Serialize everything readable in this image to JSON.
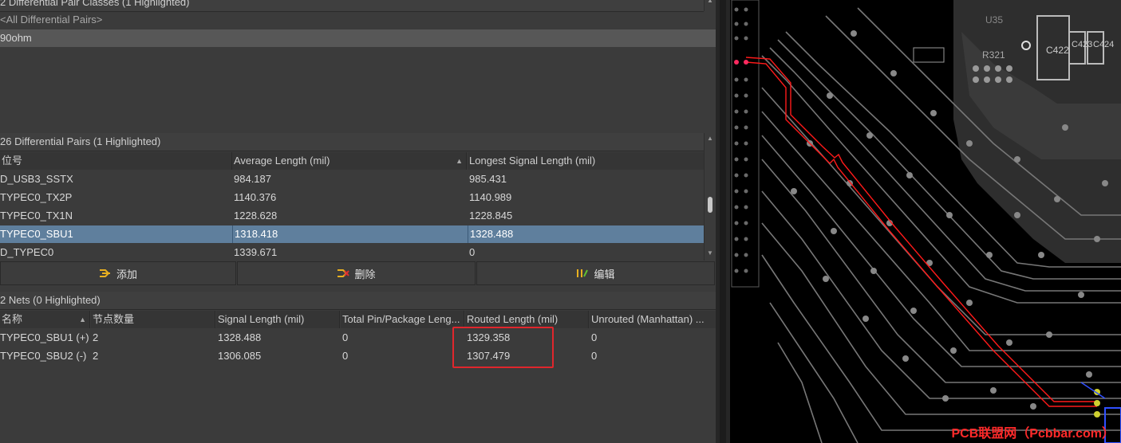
{
  "classes_section": {
    "title": "2 Differential Pair Classes (1 Highlighted)",
    "items": [
      "<All Differential Pairs>",
      "90ohm"
    ]
  },
  "pairs_section": {
    "title": "26 Differential Pairs (1 Highlighted)",
    "columns": [
      "位号",
      "Average Length (mil)",
      "Longest Signal Length (mil)"
    ],
    "rows": [
      [
        "D_USB3_SSTX",
        "984.187",
        "985.431"
      ],
      [
        "TYPEC0_TX2P",
        "1140.376",
        "1140.989"
      ],
      [
        "TYPEC0_TX1N",
        "1228.628",
        "1228.845"
      ],
      [
        "TYPEC0_SBU1",
        "1318.418",
        "1328.488"
      ],
      [
        "D_TYPEC0",
        "1339.671",
        "0"
      ]
    ],
    "highlighted_row": "TYPEC0_SBU1"
  },
  "buttons": {
    "add": "添加",
    "delete": "删除",
    "edit": "编辑"
  },
  "nets_section": {
    "title": "2 Nets (0 Highlighted)",
    "columns": [
      "名称",
      "节点数量",
      "Signal Length (mil)",
      "Total Pin/Package Leng...",
      "Routed Length (mil)",
      "Unrouted (Manhattan) ..."
    ],
    "rows": [
      [
        "TYPEC0_SBU1 (+)",
        "2",
        "1328.488",
        "0",
        "1329.358",
        "0"
      ],
      [
        "TYPEC0_SBU2 (-)",
        "2",
        "1306.085",
        "0",
        "1307.479",
        "0"
      ]
    ]
  },
  "pcb": {
    "labels": [
      "U35",
      "R321",
      "C422",
      "C423",
      "C424"
    ],
    "watermark": "PCB联盟网（Pcbbar.com）"
  },
  "colors": {
    "highlight": "#5f7f9d",
    "annotation": "#e0262c",
    "trace_highlight": "#ff0000"
  }
}
